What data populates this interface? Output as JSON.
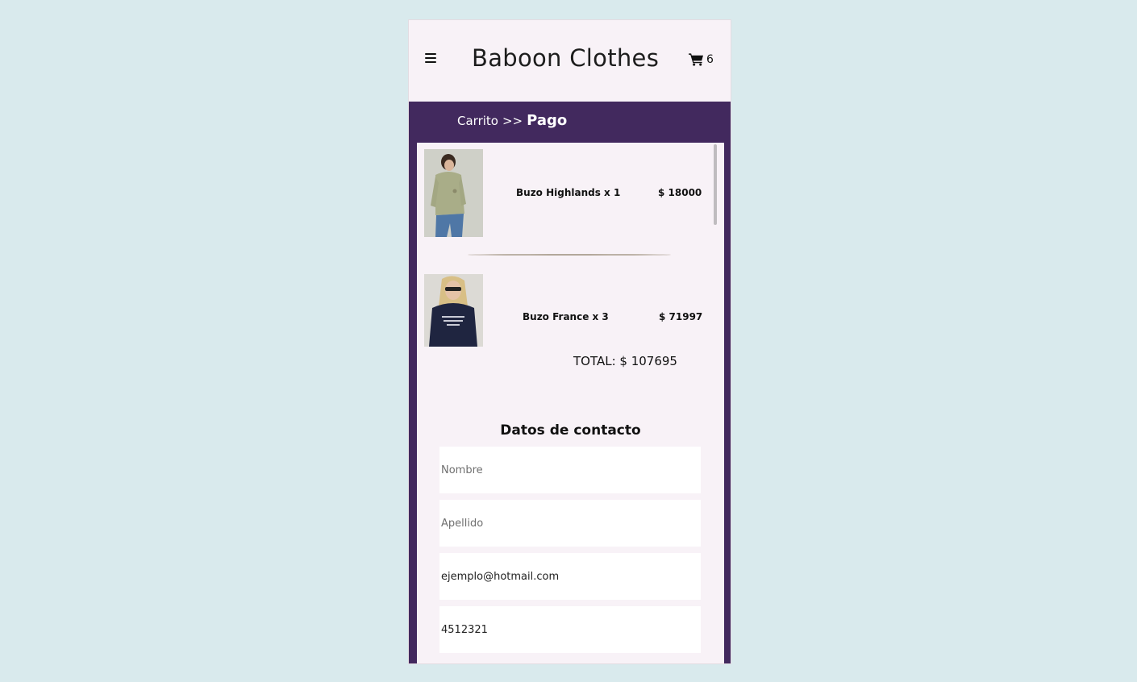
{
  "header": {
    "brand": "Baboon Clothes",
    "cart_count": "6"
  },
  "breadcrumb": {
    "link": "Carrito",
    "separator": ">>",
    "current": "Pago"
  },
  "cart": {
    "items": [
      {
        "name": "Buzo Highlands x 1",
        "price": "$ 18000"
      },
      {
        "name": "Buzo France x 3",
        "price": "$ 71997"
      }
    ],
    "total": "TOTAL: $ 107695"
  },
  "contact": {
    "title": "Datos de contacto",
    "first_name": {
      "placeholder": "Nombre",
      "value": ""
    },
    "last_name": {
      "placeholder": "Apellido",
      "value": ""
    },
    "email": {
      "placeholder": "",
      "value": "ejemplo@hotmail.com"
    },
    "phone": {
      "placeholder": "",
      "value": "4512321"
    }
  },
  "colors": {
    "page_bg": "#d9eaed",
    "panel_bg": "#f8f2f7",
    "accent_purple": "#42295e",
    "divider": "#b3a89a"
  }
}
